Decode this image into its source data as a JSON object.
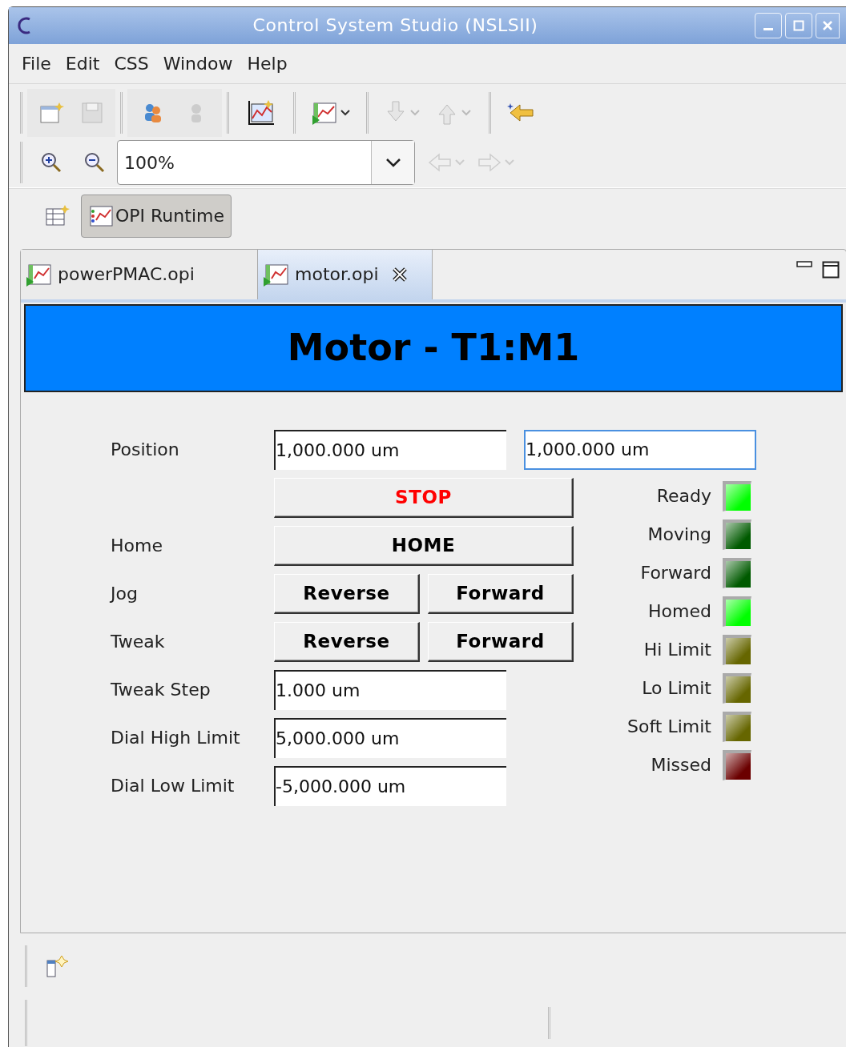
{
  "window": {
    "title": "Control System Studio (NSLSII)"
  },
  "menu": [
    "File",
    "Edit",
    "CSS",
    "Window",
    "Help"
  ],
  "zoom": {
    "value": "100%"
  },
  "perspective": {
    "label": "OPI Runtime",
    "selected": true
  },
  "tabs": [
    {
      "label": "powerPMAC.opi",
      "selected": false
    },
    {
      "label": "motor.opi",
      "selected": true
    }
  ],
  "header": "Motor - T1:M1",
  "rows": [
    {
      "label": "Position",
      "kind": "fields",
      "fields": [
        {
          "value": "1,000.000 um",
          "focused": false
        },
        {
          "value": "1,000.000 um",
          "focused": true
        }
      ]
    },
    {
      "kind": "buttons",
      "buttons": [
        {
          "label": "STOP",
          "color": "#ff0000"
        }
      ]
    },
    {
      "label": "Home",
      "kind": "buttons",
      "buttons": [
        {
          "label": "HOME",
          "color": "#000000"
        }
      ]
    },
    {
      "label": "Jog",
      "kind": "buttons",
      "buttons": [
        {
          "label": "Reverse",
          "color": "#000000"
        },
        {
          "label": "Forward",
          "color": "#000000"
        }
      ]
    },
    {
      "label": "Tweak",
      "kind": "buttons",
      "buttons": [
        {
          "label": "Reverse",
          "color": "#000000"
        },
        {
          "label": "Forward",
          "color": "#000000"
        }
      ]
    },
    {
      "label": "Tweak Step",
      "kind": "fields",
      "fields": [
        {
          "value": "1.000 um",
          "focused": false
        }
      ]
    },
    {
      "label": "Dial High Limit",
      "kind": "fields",
      "fields": [
        {
          "value": "5,000.000 um",
          "focused": false
        }
      ]
    },
    {
      "label": "Dial Low Limit",
      "kind": "fields",
      "fields": [
        {
          "value": "-5,000.000 um",
          "focused": false
        }
      ]
    }
  ],
  "leds": [
    {
      "label": "Ready",
      "color": "#00ff00"
    },
    {
      "label": "Moving",
      "color": "#005a00"
    },
    {
      "label": "Forward",
      "color": "#005a00"
    },
    {
      "label": "Homed",
      "color": "#00ff00"
    },
    {
      "label": "Hi Limit",
      "color": "#666600"
    },
    {
      "label": "Lo Limit",
      "color": "#666600"
    },
    {
      "label": "Soft Limit",
      "color": "#666600"
    },
    {
      "label": "Missed",
      "color": "#6b0000"
    }
  ]
}
